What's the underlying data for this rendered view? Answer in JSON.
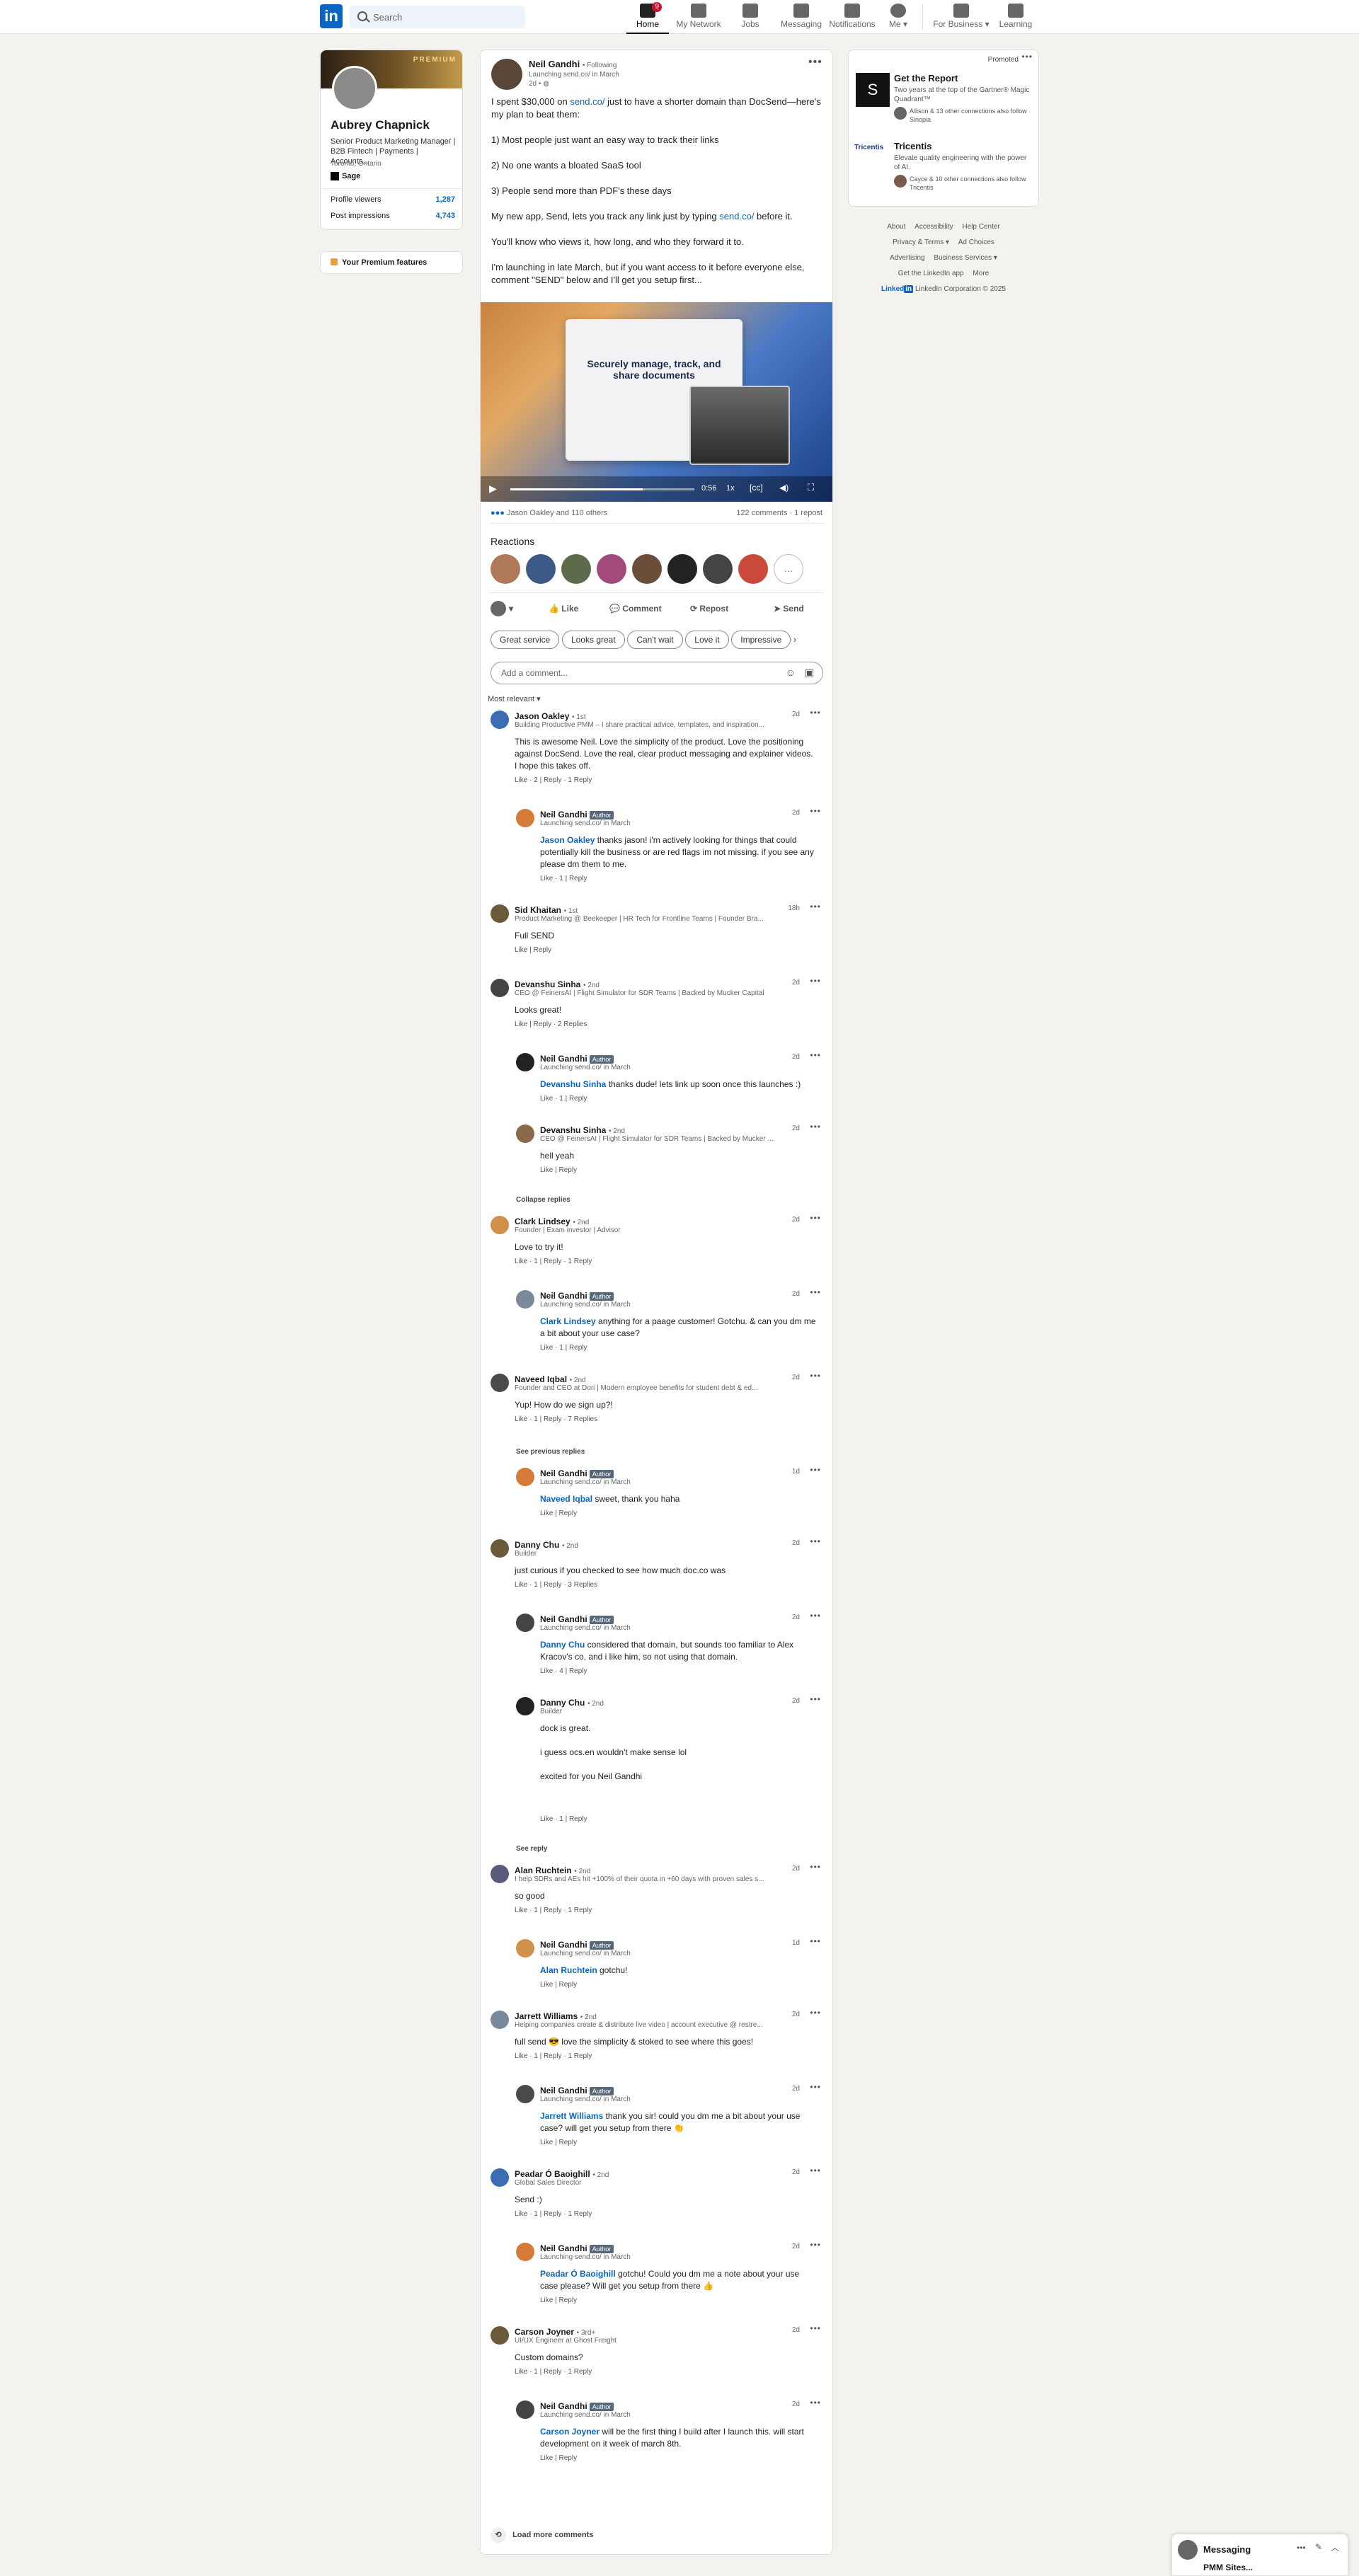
{
  "nav": {
    "search_placeholder": "Search",
    "items": [
      {
        "label": "Home",
        "badge": "9"
      },
      {
        "label": "My Network"
      },
      {
        "label": "Jobs"
      },
      {
        "label": "Messaging"
      },
      {
        "label": "Notifications"
      },
      {
        "label": "Me"
      },
      {
        "label": "For Business"
      },
      {
        "label": "Learning"
      }
    ]
  },
  "profile": {
    "banner_text": "PREMIUM",
    "name": "Aubrey Chapnick",
    "headline": "Senior Product Marketing Manager | B2B Fintech | Payments | Accounts...",
    "location": "Toronto, Ontario",
    "company": "Sage",
    "stats": [
      {
        "label": "Profile viewers",
        "value": "1,287"
      },
      {
        "label": "Post impressions",
        "value": "4,743"
      }
    ],
    "premium_link": "Your Premium features"
  },
  "post": {
    "author": "Neil Gandhi",
    "follow": "• Following",
    "subtitle": "Launching send.co/ in March",
    "time": "2d •",
    "paragraphs": [
      {
        "pre": "I spent $30,000 on ",
        "link": "send.co/",
        "post": " just to have a shorter domain than DocSend—here's my plan to beat them:"
      },
      {
        "pre": "1) Most people just want an easy way to track their links",
        "link": "",
        "post": ""
      },
      {
        "pre": "2) No one wants a bloated SaaS tool",
        "link": "",
        "post": ""
      },
      {
        "pre": "3) People send more than PDF's these days",
        "link": "",
        "post": ""
      },
      {
        "pre": "My new app, Send, lets you track any link just by typing ",
        "link": "send.co/",
        "post": " before it."
      },
      {
        "pre": "You'll know who views it, how long, and who they forward it to.",
        "link": "",
        "post": ""
      },
      {
        "pre": "I'm launching in late March, but if you want access to it before everyone else, comment \"SEND\" below and I'll get you setup first...",
        "link": "",
        "post": ""
      }
    ],
    "video": {
      "headline": "Securely manage, track, and share documents",
      "time": "0:56",
      "speed": "1x"
    },
    "reactions_text": "Jason Oakley and 110 others",
    "comments_count": "122 comments",
    "reposts": "1 repost",
    "reactions_heading": "Reactions",
    "actions": [
      "Like",
      "Comment",
      "Repost",
      "Send"
    ],
    "suggestions": [
      "Great service",
      "Looks great",
      "Can't wait",
      "Love it",
      "Impressive"
    ],
    "comment_placeholder": "Add a comment...",
    "sort": "Most relevant"
  },
  "comments": [
    {
      "name": "Jason Oakley",
      "degree": "• 1st",
      "title": "Building Productive PMM – I share practical advice, templates, and inspiration...",
      "time": "2d",
      "text": "This is awesome Neil. Love the simplicity of the product. Love the positioning against DocSend. Love the real, clear product messaging and explainer videos. I hope this takes off.",
      "actions": "Like · 2 | Reply · 1 Reply"
    },
    {
      "reply": true,
      "name": "Neil Gandhi",
      "tag": "Author",
      "title": "Launching send.co/ in March",
      "time": "2d",
      "mention": "Jason Oakley",
      "text": " thanks jason! i'm actively looking for things that could potentially kill the business or are red flags im not missing. if you see any please dm them to me.",
      "actions": "Like · 1 | Reply"
    },
    {
      "name": "Sid Khaitan",
      "degree": "• 1st",
      "title": "Product Marketing @ Beekeeper | HR Tech for Frontline Teams | Founder Bra...",
      "time": "18h",
      "text": "Full SEND",
      "actions": "Like | Reply"
    },
    {
      "name": "Devanshu Sinha",
      "degree": "• 2nd",
      "title": "CEO @ FeinersAI | Flight Simulator for SDR Teams | Backed by Mucker Capital",
      "time": "2d",
      "text": "Looks great!",
      "actions": "Like | Reply · 2 Replies"
    },
    {
      "reply": true,
      "name": "Neil Gandhi",
      "tag": "Author",
      "title": "Launching send.co/ in March",
      "time": "2d",
      "mention": "Devanshu Sinha",
      "text": " thanks dude! lets link up soon once this launches :)",
      "actions": "Like · 1 | Reply"
    },
    {
      "reply": true,
      "name": "Devanshu Sinha",
      "degree": "• 2nd",
      "title": "CEO @ FeinersAI | Flight Simulator for SDR Teams | Backed by Mucker ...",
      "time": "2d",
      "text": "hell yeah",
      "actions": "Like | Reply"
    },
    {
      "link_only": "Collapse replies"
    },
    {
      "name": "Clark Lindsey",
      "degree": "• 2nd",
      "title": "Founder | Exam investor | Advisor",
      "time": "2d",
      "text": "Love to try it!",
      "actions": "Like · 1 | Reply · 1 Reply"
    },
    {
      "reply": true,
      "name": "Neil Gandhi",
      "tag": "Author",
      "title": "Launching send.co/ in March",
      "time": "2d",
      "mention": "Clark Lindsey",
      "text": " anything for a paage customer! Gotchu. & can you dm me a bit about your use case?",
      "actions": "Like · 1 | Reply"
    },
    {
      "name": "Naveed Iqbal",
      "degree": "• 2nd",
      "title": "Founder and CEO at Dori | Modern employee benefits for student debt & ed...",
      "time": "2d",
      "text": "Yup! How do we sign up?!",
      "actions": "Like · 1 | Reply · 7 Replies"
    },
    {
      "link_only": "See previous replies"
    },
    {
      "reply": true,
      "name": "Neil Gandhi",
      "tag": "Author",
      "title": "Launching send.co/ in March",
      "time": "1d",
      "mention": "Naveed Iqbal",
      "text": " sweet, thank you haha",
      "actions": "Like | Reply"
    },
    {
      "name": "Danny Chu",
      "degree": "• 2nd",
      "title": "Builder",
      "time": "2d",
      "text": "just curious if you checked to see how much doc.co was",
      "actions": "Like · 1 | Reply · 3 Replies"
    },
    {
      "reply": true,
      "name": "Neil Gandhi",
      "tag": "Author",
      "title": "Launching send.co/ in March",
      "time": "2d",
      "mention": "Danny Chu",
      "text": " considered that domain, but sounds too familiar to Alex Kracov's co, and i like him, so not using that domain.",
      "actions": "Like · 4 | Reply"
    },
    {
      "reply": true,
      "name": "Danny Chu",
      "degree": "• 2nd",
      "title": "Builder",
      "time": "2d",
      "text": "dock is great.\n\ni guess ocs.en wouldn't make sense lol\n\nexcited for you Neil Gandhi",
      "actions": "Like · 1 | Reply"
    },
    {
      "link_only": "See reply"
    },
    {
      "name": "Alan Ruchtein",
      "degree": "• 2nd",
      "title": "I help SDRs and AEs hit +100% of their quota in +60 days with proven sales s...",
      "time": "2d",
      "text": "so good",
      "actions": "Like · 1 | Reply · 1 Reply"
    },
    {
      "reply": true,
      "name": "Neil Gandhi",
      "tag": "Author",
      "title": "Launching send.co/ in March",
      "time": "1d",
      "mention": "Alan Ruchtein",
      "text": " gotchu!",
      "actions": "Like | Reply"
    },
    {
      "name": "Jarrett Williams",
      "degree": "• 2nd",
      "title": "Helping companies create & distribute live video | account executive @ restre...",
      "time": "2d",
      "text": "full send 😎 love the simplicity & stoked to see where this goes!",
      "actions": "Like · 1 | Reply · 1 Reply"
    },
    {
      "reply": true,
      "name": "Neil Gandhi",
      "tag": "Author",
      "title": "Launching send.co/ in March",
      "time": "2d",
      "mention": "Jarrett Williams",
      "text": " thank you sir! could you dm me a bit about your use case? will get you setup from there 👏",
      "actions": "Like | Reply"
    },
    {
      "name": "Peadar Ó Baoighill",
      "degree": "• 2nd",
      "title": "Global Sales Director",
      "time": "2d",
      "text": "Send :)",
      "actions": "Like · 1 | Reply · 1 Reply"
    },
    {
      "reply": true,
      "name": "Neil Gandhi",
      "tag": "Author",
      "title": "Launching send.co/ in March",
      "time": "2d",
      "mention": "Peadar Ó Baoighill",
      "text": " gotchu! Could you dm me a note about your use case please? Will get you setup from there 👍",
      "actions": "Like | Reply"
    },
    {
      "name": "Carson Joyner",
      "degree": "• 3rd+",
      "title": "UI/UX Engineer at Ghost Freight",
      "time": "2d",
      "text": "Custom domains?",
      "actions": "Like · 1 | Reply · 1 Reply"
    },
    {
      "reply": true,
      "name": "Neil Gandhi",
      "tag": "Author",
      "title": "Launching send.co/ in March",
      "time": "2d",
      "mention": "Carson Joyner",
      "text": " will be the first thing I build after I launch this. will start development on it week of march 8th.",
      "actions": "Like | Reply"
    }
  ],
  "load_more": "Load more comments",
  "ads": {
    "label": "Promoted",
    "items": [
      {
        "title": "Get the Report",
        "desc": "Two years at the top of the Gartner® Magic Quadrant™",
        "social": "Allison & 13 other connections also follow Sinopia",
        "logo": "S"
      },
      {
        "title": "Tricentis",
        "desc": "Elevate quality engineering with the power of AI.",
        "social": "Cayce & 10 other connections also follow Tricentis",
        "logo": "Tricentis"
      }
    ]
  },
  "footer": {
    "row1": [
      "About",
      "Accessibility",
      "Help Center"
    ],
    "row2": [
      "Privacy & Terms ▾",
      "Ad Choices"
    ],
    "row3": [
      "Advertising",
      "Business Services ▾"
    ],
    "row4": [
      "Get the LinkedIn app",
      "More"
    ],
    "copyright": "LinkedIn Corporation © 2025"
  },
  "messaging": {
    "label": "Messaging",
    "peek": "PMM Sites..."
  }
}
